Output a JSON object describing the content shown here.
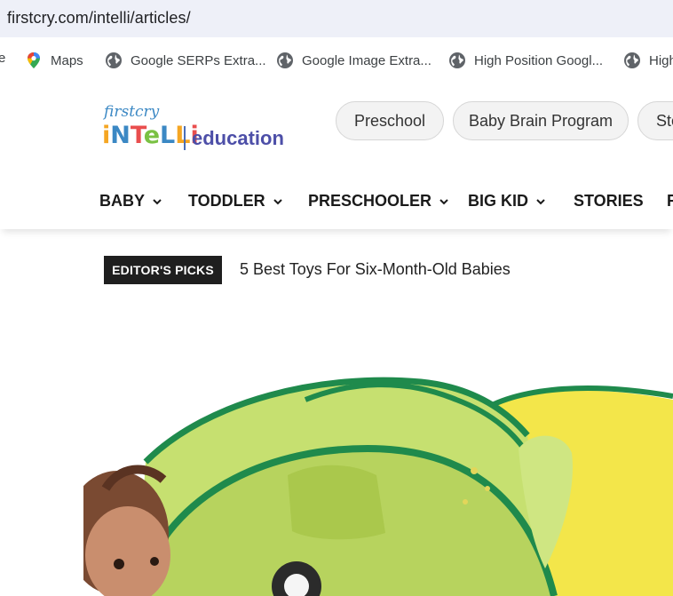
{
  "browser": {
    "url": "firstcry.com/intelli/articles/",
    "bookmarks": [
      {
        "label": "e",
        "icon": "truncated-bookmark"
      },
      {
        "label": "Maps",
        "icon": "google-maps-pin-icon"
      },
      {
        "label": "Google SERPs Extra...",
        "icon": "globe-icon"
      },
      {
        "label": "Google Image Extra...",
        "icon": "globe-icon"
      },
      {
        "label": "High Position Googl...",
        "icon": "globe-icon"
      },
      {
        "label": "High",
        "icon": "globe-icon"
      }
    ]
  },
  "site": {
    "logo": {
      "brand_small": "firstcry",
      "brand_main": "iNTeLLi",
      "section": "education"
    },
    "pills": [
      {
        "label": "Preschool"
      },
      {
        "label": "Baby Brain Program"
      },
      {
        "label": "Ste"
      }
    ],
    "nav": [
      {
        "label": "BABY",
        "has_dropdown": true
      },
      {
        "label": "TODDLER",
        "has_dropdown": true
      },
      {
        "label": "PRESCHOOLER",
        "has_dropdown": true
      },
      {
        "label": "BIG KID",
        "has_dropdown": true
      },
      {
        "label": "STORIES",
        "has_dropdown": false
      },
      {
        "label": "R",
        "has_dropdown": false
      }
    ]
  },
  "editors_picks": {
    "badge": "EDITOR'S PICKS",
    "title": "5 Best Toys For Six-Month-Old Babies"
  },
  "colors": {
    "urlbar_bg": "#eef0f8",
    "badge_bg": "#1f1f1f",
    "edu_text": "#4d4fa8",
    "tunnel_green": "#c6e070",
    "tunnel_border": "#1f8a4c",
    "tunnel_yellow": "#f3e64a"
  }
}
